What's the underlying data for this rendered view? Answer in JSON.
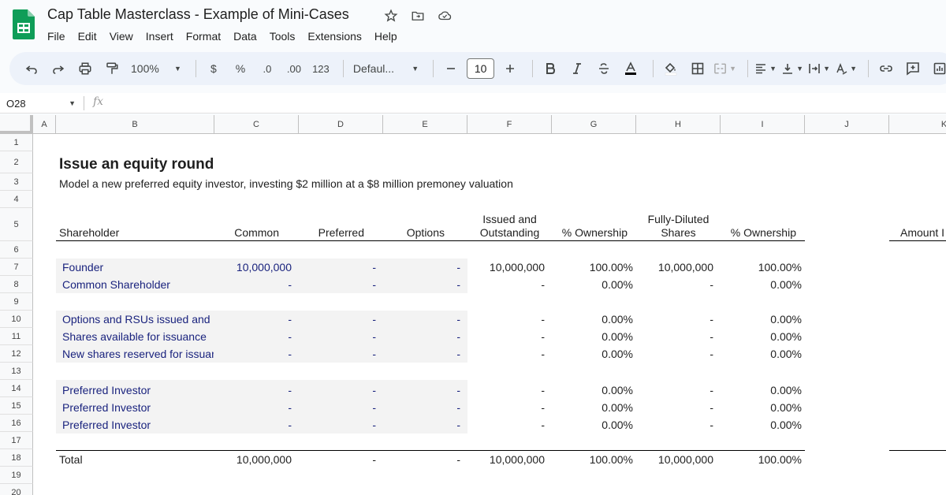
{
  "header": {
    "doc_title": "Cap Table Masterclass - Example of Mini-Cases",
    "menu": [
      "File",
      "Edit",
      "View",
      "Insert",
      "Format",
      "Data",
      "Tools",
      "Extensions",
      "Help"
    ]
  },
  "toolbar": {
    "zoom": "100%",
    "currency": "$",
    "percent": "%",
    "dec_decrease": ".0",
    "dec_increase": ".00",
    "number_format": "123",
    "font": "Defaul...",
    "font_size": "10"
  },
  "formula_bar": {
    "cell_ref": "O28",
    "fx": "fx"
  },
  "grid": {
    "column_headers": [
      "A",
      "B",
      "C",
      "D",
      "E",
      "F",
      "G",
      "H",
      "I",
      "J",
      "K"
    ],
    "row_numbers": [
      "1",
      "2",
      "3",
      "4",
      "5",
      "6",
      "7",
      "8",
      "9",
      "10",
      "11",
      "12",
      "13",
      "14",
      "15",
      "16",
      "17",
      "18",
      "19",
      "20"
    ]
  },
  "sheet": {
    "title": "Issue an equity round",
    "subtitle": "Model a new preferred equity investor, investing $2 million at a $8 million premoney valuation",
    "headers": {
      "shareholder": "Shareholder",
      "common": "Common",
      "preferred": "Preferred",
      "options": "Options",
      "issued_line1": "Issued and",
      "issued_line2": "Outstanding",
      "ownership1": "% Ownership",
      "fd_line1": "Fully-Diluted",
      "fd_line2": "Shares",
      "ownership2": "% Ownership",
      "amount": "Amount I"
    },
    "rows": [
      {
        "name": "Founder",
        "common": "10,000,000",
        "preferred": "-",
        "options": "-",
        "issued": "10,000,000",
        "own1": "100.00%",
        "fd": "10,000,000",
        "own2": "100.00%"
      },
      {
        "name": "Common Shareholder",
        "common": "-",
        "preferred": "-",
        "options": "-",
        "issued": "-",
        "own1": "0.00%",
        "fd": "-",
        "own2": "0.00%"
      },
      {
        "name": "Options and RSUs issued and",
        "common": "-",
        "preferred": "-",
        "options": "-",
        "issued": "-",
        "own1": "0.00%",
        "fd": "-",
        "own2": "0.00%"
      },
      {
        "name": "Shares available for issuance",
        "common": "-",
        "preferred": "-",
        "options": "-",
        "issued": "-",
        "own1": "0.00%",
        "fd": "-",
        "own2": "0.00%"
      },
      {
        "name": "New shares reserved for issuance",
        "common": "-",
        "preferred": "-",
        "options": "-",
        "issued": "-",
        "own1": "0.00%",
        "fd": "-",
        "own2": "0.00%"
      },
      {
        "name": "Preferred Investor",
        "common": "-",
        "preferred": "-",
        "options": "-",
        "issued": "-",
        "own1": "0.00%",
        "fd": "-",
        "own2": "0.00%"
      },
      {
        "name": "Preferred Investor",
        "common": "-",
        "preferred": "-",
        "options": "-",
        "issued": "-",
        "own1": "0.00%",
        "fd": "-",
        "own2": "0.00%"
      },
      {
        "name": "Preferred Investor",
        "common": "-",
        "preferred": "-",
        "options": "-",
        "issued": "-",
        "own1": "0.00%",
        "fd": "-",
        "own2": "0.00%"
      }
    ],
    "total": {
      "name": "Total",
      "common": "10,000,000",
      "preferred": "-",
      "options": "-",
      "issued": "10,000,000",
      "own1": "100.00%",
      "fd": "10,000,000",
      "own2": "100.00%"
    }
  }
}
